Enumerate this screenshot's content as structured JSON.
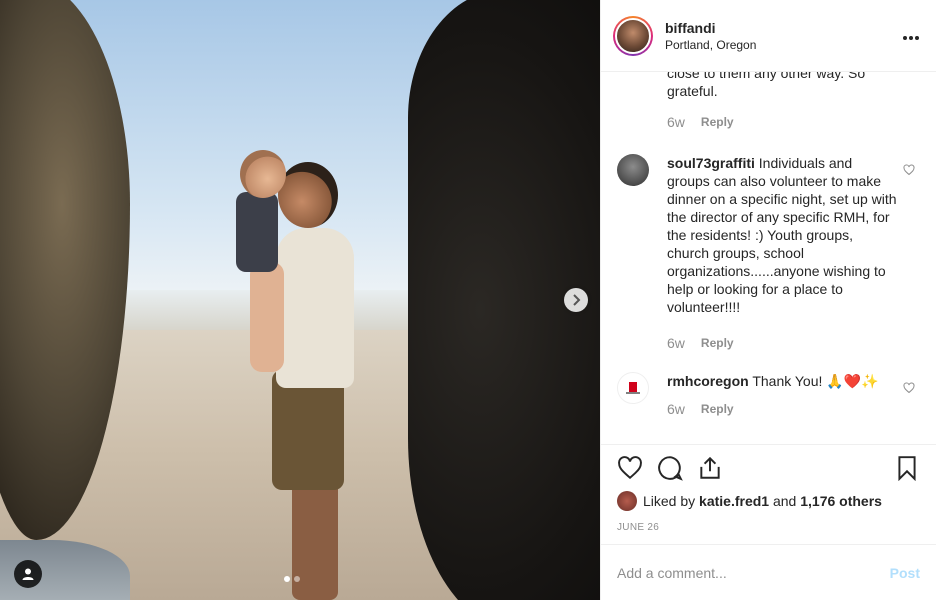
{
  "header": {
    "username": "biffandi",
    "location": "Portland, Oregon",
    "more_icon": "ellipsis-icon"
  },
  "comments": {
    "prev_tail": "close to them any other way. So grateful.",
    "prev_meta": {
      "time": "6w",
      "reply": "Reply"
    },
    "items": [
      {
        "user": "soul73graffiti",
        "text": "Individuals and groups can also volunteer to make dinner on a specific night, set up with the director of any specific RMH, for the residents! :) Youth groups, church groups, school organizations......anyone wishing to help or looking for a place to volunteer!!!!",
        "time": "6w",
        "reply": "Reply"
      },
      {
        "user": "rmhcoregon",
        "text": "Thank You! 🙏❤️✨",
        "time": "6w",
        "reply": "Reply"
      }
    ]
  },
  "actions": {
    "liked_by_prefix": "Liked by",
    "liked_by_user": "katie.fred1",
    "liked_by_and": "and",
    "liked_by_others": "1,176 others",
    "date": "JUNE 26"
  },
  "add_comment": {
    "placeholder": "Add a comment...",
    "post_label": "Post"
  },
  "colors": {
    "post_disabled": "#b2dffc",
    "muted": "#8e8e8e"
  }
}
